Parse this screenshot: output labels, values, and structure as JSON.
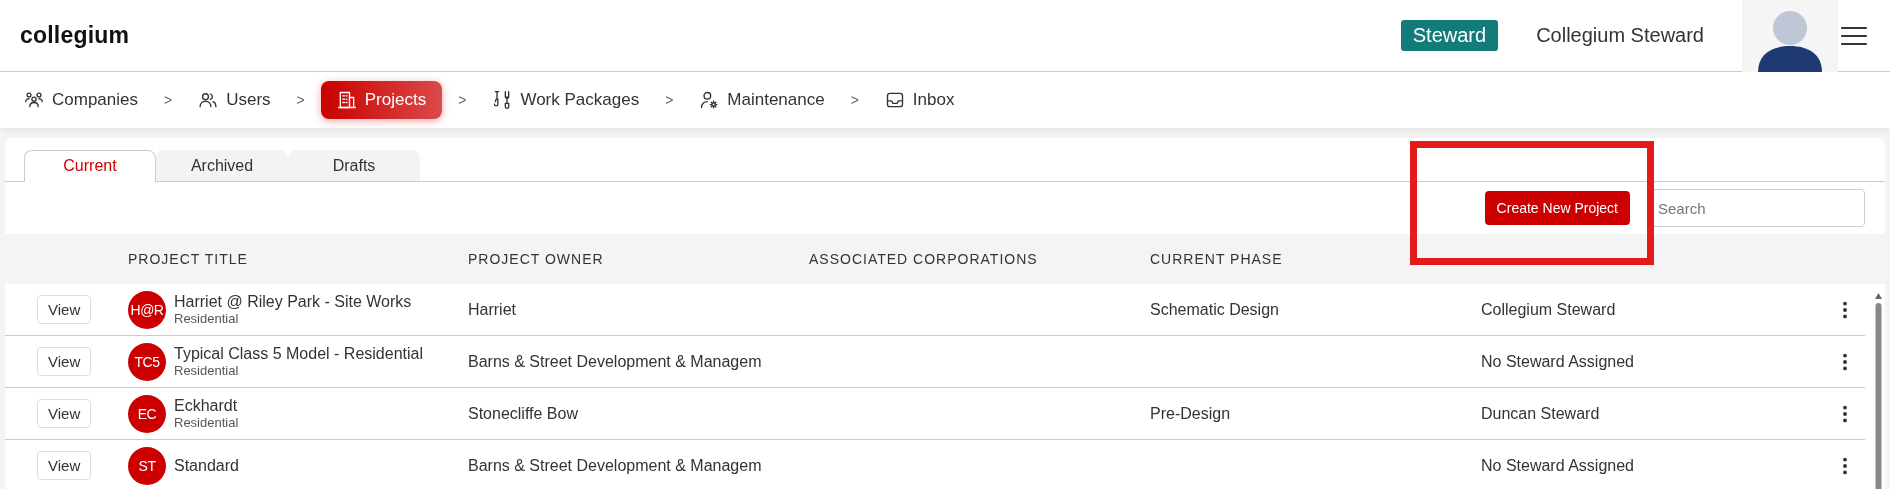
{
  "header": {
    "logo": "collegium",
    "role_badge": "Steward",
    "user_name": "Collegium Steward"
  },
  "nav": [
    {
      "kind": "companies",
      "label": "Companies",
      "selected": false
    },
    {
      "kind": "separator",
      "label": ">"
    },
    {
      "kind": "users",
      "label": "Users",
      "selected": false
    },
    {
      "kind": "separator",
      "label": ">"
    },
    {
      "kind": "projects",
      "label": "Projects",
      "selected": true
    },
    {
      "kind": "separator",
      "label": ">"
    },
    {
      "kind": "work",
      "label": "Work Packages",
      "selected": false
    },
    {
      "kind": "separator",
      "label": ">"
    },
    {
      "kind": "maintenance",
      "label": "Maintenance",
      "selected": false
    },
    {
      "kind": "separator",
      "label": ">"
    },
    {
      "kind": "inbox",
      "label": "Inbox",
      "selected": false
    }
  ],
  "tabs": [
    {
      "label": "Current",
      "selected": true
    },
    {
      "label": "Archived",
      "selected": false
    },
    {
      "label": "Drafts",
      "selected": false
    }
  ],
  "toolbar": {
    "create_button": "Create New Project",
    "search_placeholder": "Search"
  },
  "table": {
    "columns": [
      "PROJECT TITLE",
      "PROJECT OWNER",
      "ASSOCIATED CORPORATIONS",
      "CURRENT PHASE"
    ],
    "rows": [
      {
        "view": "View",
        "initials": "H@R",
        "title": "Harriet @ Riley Park - Site Works",
        "type": "Residential",
        "owner": "Harriet",
        "phase": "Schematic Design",
        "steward": "Collegium Steward"
      },
      {
        "view": "View",
        "initials": "TC5",
        "title": "Typical Class 5 Model - Residential",
        "type": "Residential",
        "owner": "Barns & Street Development & Managem",
        "steward": "No Steward Assigned"
      },
      {
        "view": "View",
        "initials": "EC",
        "title": "Eckhardt",
        "type": "Residential",
        "owner": "Stonecliffe Bow",
        "phase": "Pre-Design",
        "steward": "Duncan Steward"
      },
      {
        "view": "View",
        "initials": "ST",
        "title": "Standard",
        "owner": "Barns & Street Development & Managem",
        "steward": "No Steward Assigned"
      }
    ]
  }
}
